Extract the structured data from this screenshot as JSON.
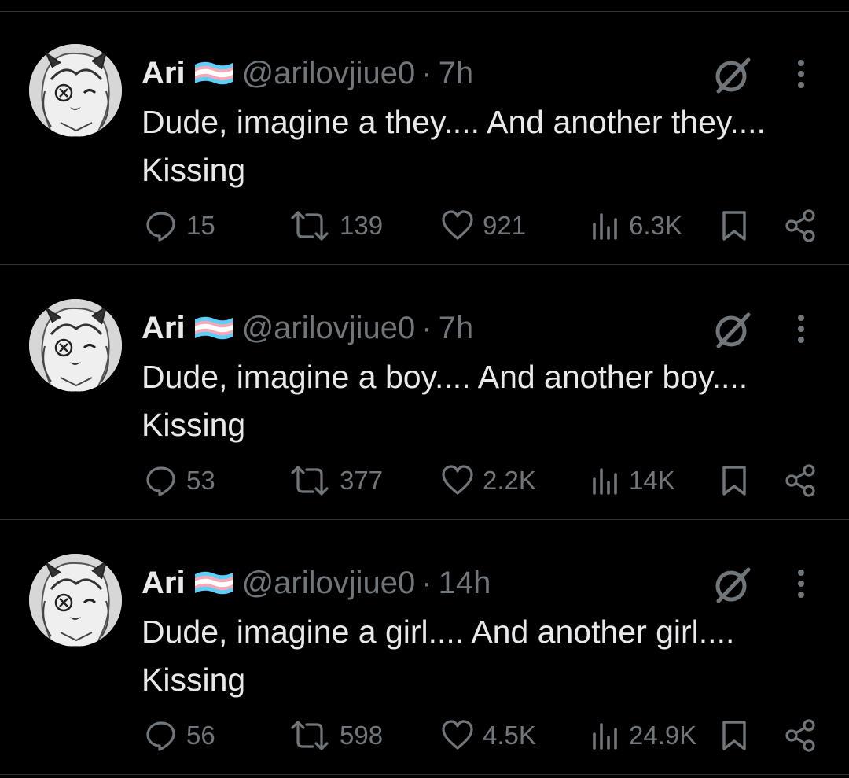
{
  "tweets": [
    {
      "name": "Ari",
      "handle": "@arilovjiue0",
      "separator": "·",
      "time": "7h",
      "text": "Dude, imagine a they.... And another they.... Kissing",
      "replies": "15",
      "retweets": "139",
      "likes": "921",
      "views": "6.3K"
    },
    {
      "name": "Ari",
      "handle": "@arilovjiue0",
      "separator": "·",
      "time": "7h",
      "text": "Dude, imagine a boy.... And another boy.... Kissing",
      "replies": "53",
      "retweets": "377",
      "likes": "2.2K",
      "views": "14K"
    },
    {
      "name": "Ari",
      "handle": "@arilovjiue0",
      "separator": "·",
      "time": "14h",
      "text": "Dude, imagine a girl.... And another girl.... Kissing",
      "replies": "56",
      "retweets": "598",
      "likes": "4.5K",
      "views": "24.9K"
    }
  ],
  "icons": {
    "avatar": "avatar-drawing",
    "flag": "trans-flag-emoji",
    "grok": "grok-icon",
    "more": "more-vertical-icon",
    "reply": "reply-icon",
    "retweet": "retweet-icon",
    "like": "heart-icon",
    "views": "views-icon",
    "bookmark": "bookmark-icon",
    "share": "share-icon"
  },
  "colors": {
    "background": "#000000",
    "primary_text": "#e7e9ea",
    "secondary_text": "#71767b",
    "divider": "#2f3336",
    "flag_blue": "#5bcefa",
    "flag_pink": "#f5a9b8",
    "flag_white": "#ffffff"
  }
}
